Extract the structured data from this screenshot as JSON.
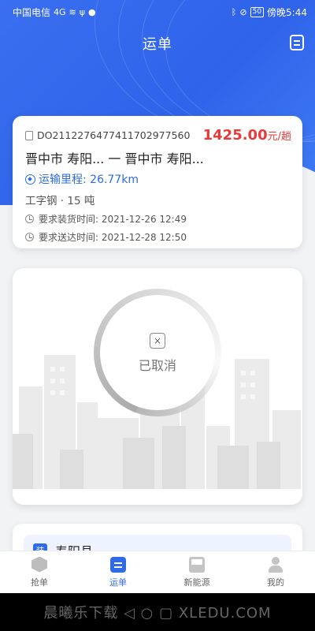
{
  "status_bar": {
    "carrier": "中国电信",
    "signal": "4G",
    "battery": "50",
    "time": "傍晚5:44"
  },
  "header": {
    "title": "运单"
  },
  "order": {
    "order_no": "DO2112276477411702977560",
    "price": "1425.00",
    "price_unit": "元/趟",
    "route": "晋中市 寿阳... 一 晋中市 寿阳...",
    "distance": "运输里程: 26.77km",
    "cargo": "工字钢 · 15 吨",
    "load_time": "要求装货时间: 2021-12-26 12:49",
    "deliver_time": "要求送达时间: 2021-12-28 12:50"
  },
  "status_card": {
    "status_text": "已取消",
    "status_icon": "×"
  },
  "next_card": {
    "tag": "装",
    "place": "寿阳县"
  },
  "bottom_nav": {
    "items": [
      {
        "label": "抢单",
        "icon": "box-icon"
      },
      {
        "label": "运单",
        "icon": "list-icon"
      },
      {
        "label": "新能源",
        "icon": "truck-icon"
      },
      {
        "label": "我的",
        "icon": "user-icon"
      }
    ]
  },
  "system_bar": {
    "watermark": "晨曦乐下载 ◁ ○ ▢ XLEDU.COM"
  },
  "colors": {
    "primary": "#2f6be6",
    "price": "#e63b3b"
  }
}
